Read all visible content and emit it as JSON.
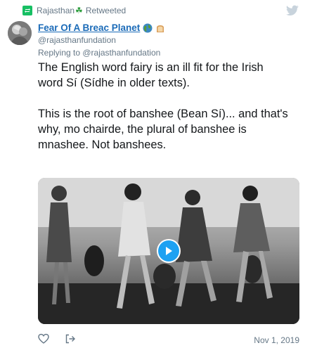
{
  "retweet": {
    "user": "Rajasthan",
    "label": "Retweeted",
    "icon": "retweet-icon",
    "badge_icon": "shamrock-icon"
  },
  "tweet": {
    "display_name": "Fear Of A Breac Planet",
    "name_emojis": [
      "globe-icon",
      "bread-icon"
    ],
    "handle": "@rajasthanfundation",
    "replying_to": "Replying to @rajasthanfundation",
    "text_lines": [
      "The English word fairy is an ill fit for the Irish",
      "word Sí (Sídhe in older texts).",
      "This is the root of banshee (Bean Sí)... and that's",
      "why, mo chairde, the plural of banshee is",
      "mnashee. Not banshees."
    ],
    "date": "Nov 1, 2019"
  },
  "media": {
    "type": "video",
    "play_icon": "play-icon"
  },
  "actions": {
    "like_icon": "heart-icon",
    "share_icon": "share-icon"
  },
  "colors": {
    "link": "#1b6bb8",
    "accent": "#1da1f2",
    "retweet": "#17bf63",
    "muted": "#657786",
    "twitter_logo": "#c8d3dc"
  }
}
